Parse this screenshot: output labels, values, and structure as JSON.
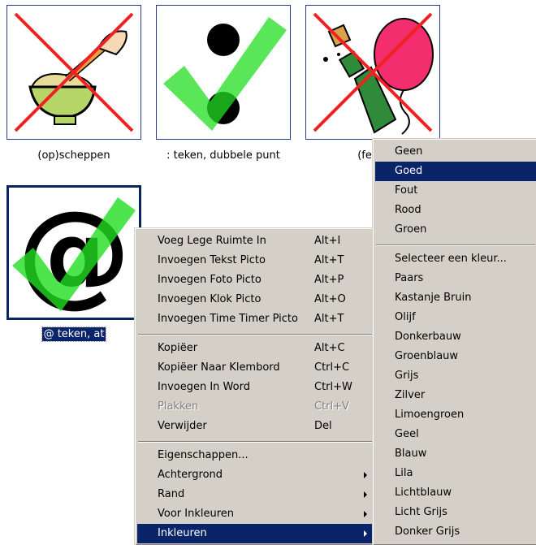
{
  "pictos": [
    {
      "caption": "(op)scheppen"
    },
    {
      "caption": ": teken, dubbele punt"
    },
    {
      "caption": "(feest"
    },
    {
      "caption": "@ teken, at"
    }
  ],
  "context_menu": {
    "groups": [
      [
        {
          "label": "Voeg Lege Ruimte In",
          "shortcut": "Alt+I"
        },
        {
          "label": "Invoegen Tekst Picto",
          "shortcut": "Alt+T"
        },
        {
          "label": "Invoegen Foto Picto",
          "shortcut": "Alt+P"
        },
        {
          "label": "Invoegen Klok Picto",
          "shortcut": "Alt+O"
        },
        {
          "label": "Invoegen Time Timer Picto",
          "shortcut": "Alt+T"
        }
      ],
      [
        {
          "label": "Kopiëer",
          "shortcut": "Alt+C"
        },
        {
          "label": "Kopiëer Naar Klembord",
          "shortcut": "Ctrl+C"
        },
        {
          "label": "Invoegen In Word",
          "shortcut": "Ctrl+W"
        },
        {
          "label": "Plakken",
          "shortcut": "Ctrl+V",
          "disabled": true
        },
        {
          "label": "Verwijder",
          "shortcut": "Del"
        }
      ],
      [
        {
          "label": "Eigenschappen...",
          "shortcut": ""
        },
        {
          "label": "Achtergrond",
          "shortcut": "",
          "submenu": true
        },
        {
          "label": "Rand",
          "shortcut": "",
          "submenu": true
        },
        {
          "label": "Voor Inkleuren",
          "shortcut": "",
          "submenu": true
        },
        {
          "label": "Inkleuren",
          "shortcut": "",
          "submenu": true,
          "highlighted": true
        }
      ]
    ]
  },
  "submenu": {
    "group1": [
      "Geen",
      "Goed",
      "Fout",
      "Rood",
      "Groen"
    ],
    "highlighted": "Goed",
    "group2": [
      "Selecteer een kleur...",
      "Paars",
      "Kastanje Bruin",
      "Olijf",
      "Donkerbauw",
      "Groenblauw",
      "Grijs",
      "Zilver",
      "Limoengroen",
      "Geel",
      "Blauw",
      "Lila",
      "Lichtblauw",
      "Licht Grijs",
      "Donker Grijs"
    ]
  },
  "colors": {
    "menu_bg": "#d4d0c8",
    "highlight": "#0a246a",
    "check_green": "#22dd22",
    "cross_red": "#ee2222",
    "tile_border": "#2b3b8c"
  },
  "icons": [
    "cross-overlay-icon",
    "check-overlay-icon",
    "bowl-scoop-icon",
    "colon-icon",
    "champagne-balloon-icon",
    "at-sign-icon",
    "submenu-arrow-icon"
  ]
}
